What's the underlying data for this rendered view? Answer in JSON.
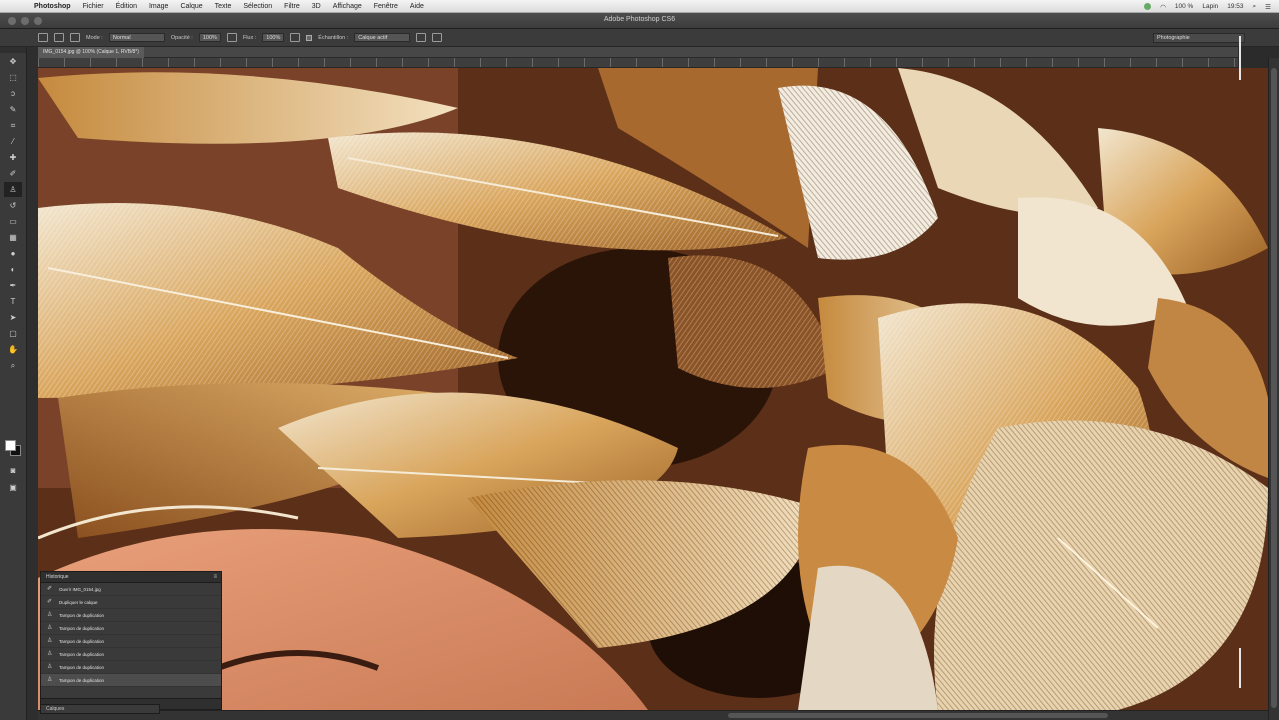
{
  "menubar": {
    "items": [
      "Photoshop",
      "Fichier",
      "Édition",
      "Image",
      "Calque",
      "Texte",
      "Sélection",
      "Filtre",
      "3D",
      "Affichage",
      "Fenêtre",
      "Aide"
    ],
    "status": {
      "battery": "100 %",
      "clock": "19:53",
      "user": "Lapin"
    }
  },
  "window": {
    "title": "Adobe Photoshop CS6"
  },
  "options": {
    "mode_label": "Mode :",
    "mode_value": "Normal",
    "opacity_label": "Opacité :",
    "opacity_value": "100%",
    "flow_label": "Flux :",
    "flow_value": "100%",
    "sample_label": "Échantillon :",
    "sample_value": "Calque actif",
    "workspace": "Photographie"
  },
  "document": {
    "tab": "IMG_0154.jpg @ 100% (Calque 1, RVB/8*)"
  },
  "history": {
    "title": "Historique",
    "items": [
      {
        "label": "Ouvrir IMG_0154.jpg",
        "icon": "brush-icon"
      },
      {
        "label": "Dupliquer le calque",
        "icon": "brush-icon"
      },
      {
        "label": "Tampon de duplication",
        "icon": "stamp-icon"
      },
      {
        "label": "Tampon de duplication",
        "icon": "stamp-icon"
      },
      {
        "label": "Tampon de duplication",
        "icon": "stamp-icon"
      },
      {
        "label": "Tampon de duplication",
        "icon": "stamp-icon"
      },
      {
        "label": "Tampon de duplication",
        "icon": "stamp-icon"
      },
      {
        "label": "Tampon de duplication",
        "icon": "stamp-icon"
      }
    ]
  },
  "bottom_panel": {
    "title": "Calques"
  },
  "colors": {
    "foreground": "#ffffff",
    "background": "#111111",
    "ui_dark": "#2b2b2b"
  }
}
